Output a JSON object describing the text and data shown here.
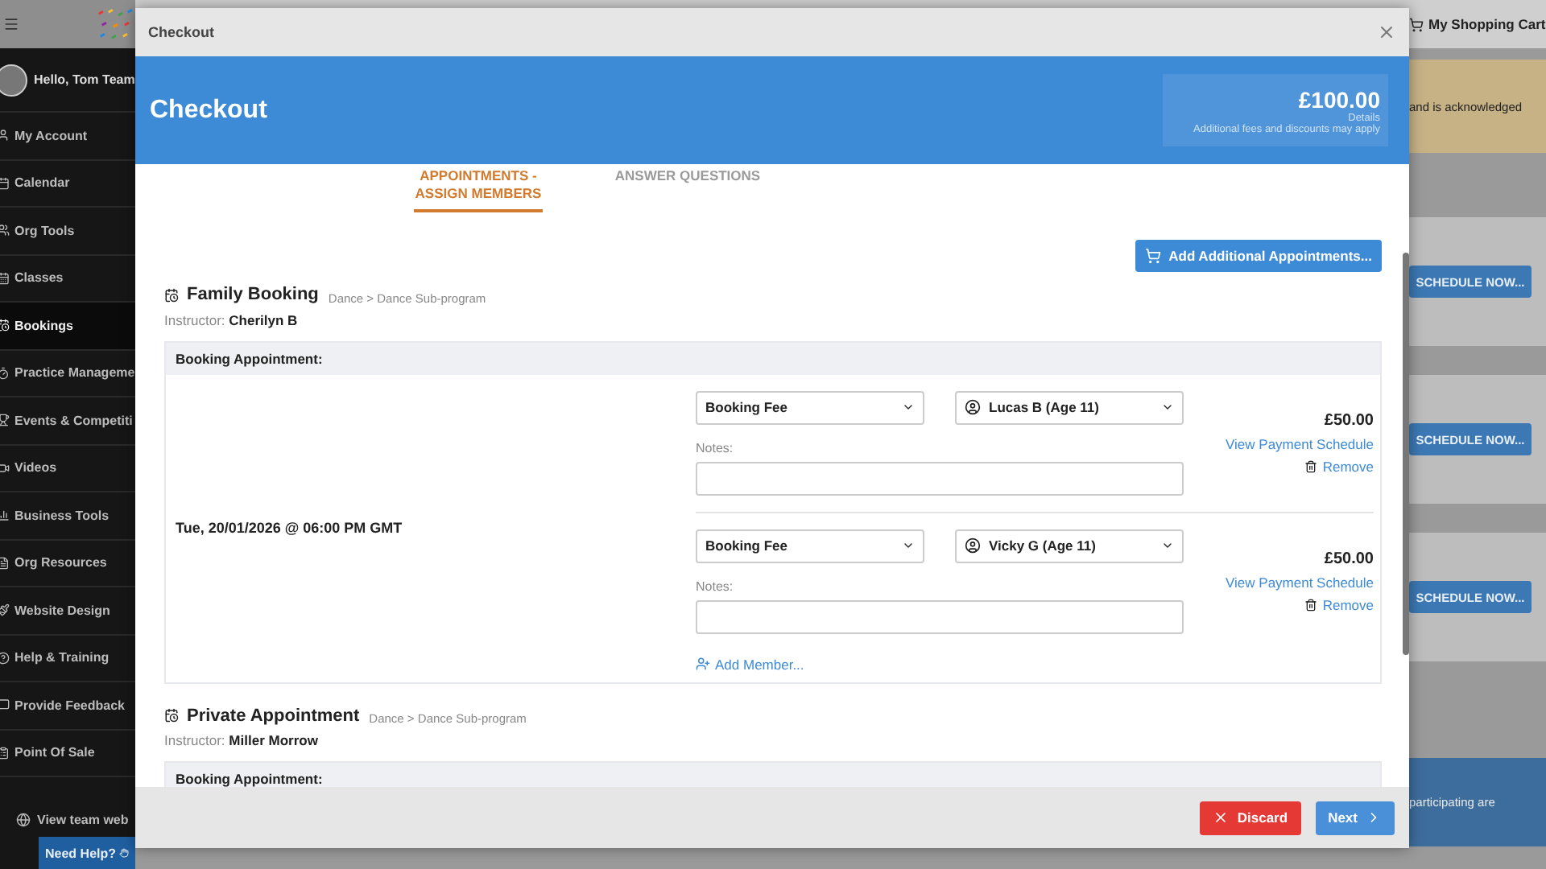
{
  "background": {
    "top_bar": {
      "cart_label": "My Shopping Cart"
    },
    "sidebar": {
      "greeting": "Hello, Tom Team",
      "items": [
        {
          "label": "My Account",
          "selected": false
        },
        {
          "label": "Calendar",
          "selected": false
        },
        {
          "label": "Org Tools",
          "selected": false
        },
        {
          "label": "Classes",
          "selected": false
        },
        {
          "label": "Bookings",
          "selected": true
        },
        {
          "label": "Practice Manageme",
          "selected": false
        },
        {
          "label": "Events & Competiti",
          "selected": false
        },
        {
          "label": "Videos",
          "selected": false
        },
        {
          "label": "Business Tools",
          "selected": false
        },
        {
          "label": "Org Resources",
          "selected": false
        },
        {
          "label": "Website Design",
          "selected": false
        },
        {
          "label": "Help & Training",
          "selected": false
        },
        {
          "label": "Provide Feedback",
          "selected": false
        },
        {
          "label": "Point Of Sale",
          "selected": false
        }
      ],
      "footer_link": "View team web",
      "help_button": "Need Help?"
    },
    "right_panel": {
      "notice": "and is acknowledged",
      "buttons": [
        "SCHEDULE NOW...",
        "SCHEDULE NOW...",
        "SCHEDULE NOW..."
      ],
      "info": "participating are"
    }
  },
  "modal": {
    "title": "Checkout",
    "header": {
      "heading": "Checkout",
      "total": "£100.00",
      "details_link": "Details",
      "note": "Additional fees and discounts may apply"
    },
    "steps": [
      {
        "label": "APPOINTMENTS - ASSIGN MEMBERS",
        "selected": true
      },
      {
        "label": "ANSWER QUESTIONS",
        "selected": false
      }
    ],
    "add_button": "Add Additional Appointments...",
    "bookings": [
      {
        "title": "Family Booking",
        "path": "Dance > Dance Sub-program",
        "instructor_label": "Instructor:",
        "instructor": "Cherilyn B",
        "appointment_label": "Booking Appointment:",
        "date": "Tue, 20/01/2026 @ 06:00 PM GMT",
        "add_member": "Add Member...",
        "members": [
          {
            "fee": "Booking Fee",
            "member": "Lucas B (Age 11)",
            "notes_label": "Notes:",
            "price": "£50.00",
            "schedule_link": "View Payment Schedule",
            "remove_label": "Remove"
          },
          {
            "fee": "Booking Fee",
            "member": "Vicky G (Age 11)",
            "notes_label": "Notes:",
            "price": "£50.00",
            "schedule_link": "View Payment Schedule",
            "remove_label": "Remove"
          }
        ]
      },
      {
        "title": "Private Appointment",
        "path": "Dance > Dance Sub-program",
        "instructor_label": "Instructor:",
        "instructor": "Miller Morrow",
        "appointment_label": "Booking Appointment:"
      }
    ],
    "footer": {
      "discard": "Discard",
      "next": "Next"
    }
  }
}
